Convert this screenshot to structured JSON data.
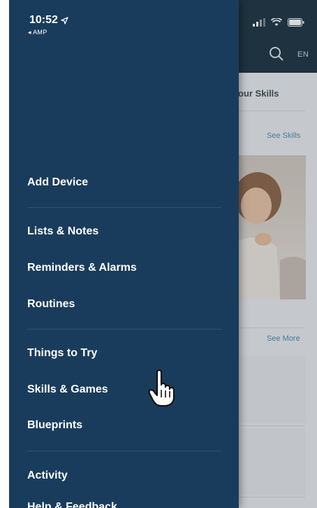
{
  "status_bar": {
    "time": "10:52",
    "back_app": "◂ AMP"
  },
  "header": {
    "language": "EN"
  },
  "background": {
    "section_title": "our Skills",
    "see_skills": "See Skills",
    "see_more": "See More"
  },
  "drawer": {
    "items": [
      {
        "label": "Add Device"
      },
      {
        "label": "Lists & Notes"
      },
      {
        "label": "Reminders & Alarms"
      },
      {
        "label": "Routines"
      },
      {
        "label": "Things to Try"
      },
      {
        "label": "Skills & Games"
      },
      {
        "label": "Blueprints"
      },
      {
        "label": "Activity"
      },
      {
        "label": "Help & Feedback"
      }
    ]
  },
  "colors": {
    "drawer_bg": "#1a3c5c",
    "header_bg": "#1d3340",
    "link": "#4a90a8"
  }
}
